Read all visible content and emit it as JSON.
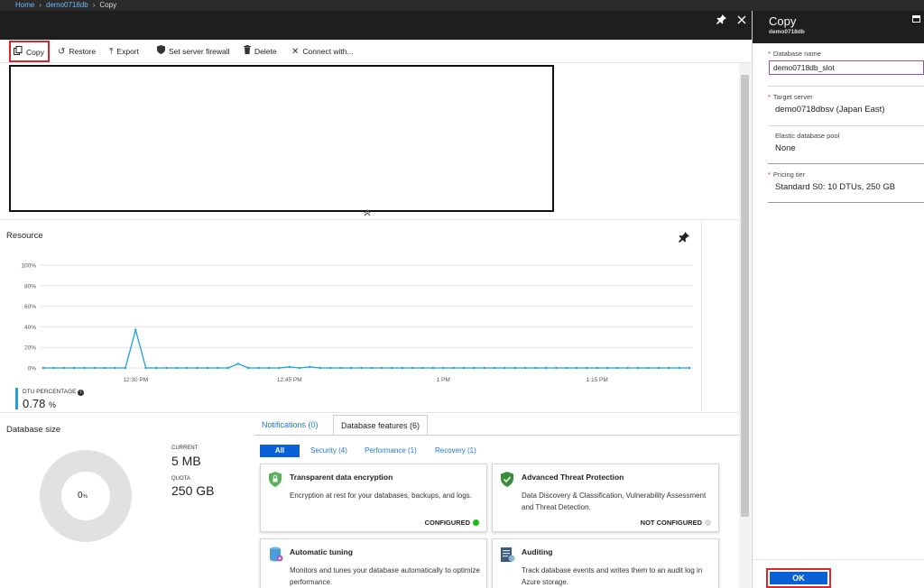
{
  "breadcrumb": {
    "home": "Home",
    "db": "demo0718db",
    "current": "Copy"
  },
  "toolbar": {
    "copy": "Copy",
    "restore": "Restore",
    "export": "Export",
    "firewall": "Set server firewall",
    "delete": "Delete",
    "connect": "Connect with..."
  },
  "resource": {
    "title": "Resource"
  },
  "chart_data": {
    "type": "line",
    "title": "",
    "y_ticks": [
      "100%",
      "80%",
      "60%",
      "40%",
      "20%",
      "0%"
    ],
    "ylim": [
      0,
      100
    ],
    "x_tick_labels": [
      "12:30 PM",
      "12:45 PM",
      "1 PM",
      "1:15 PM"
    ],
    "x_tick_positions": [
      9,
      24,
      39,
      54
    ],
    "series": [
      {
        "values": [
          0,
          0,
          0,
          0,
          0,
          0,
          0,
          0,
          0,
          37,
          0,
          0,
          0,
          0,
          0,
          0,
          0,
          0,
          0,
          4,
          0,
          0,
          0,
          0,
          1,
          0,
          1,
          0,
          0,
          0,
          0,
          0,
          0,
          0,
          0,
          0,
          0,
          0,
          0,
          0,
          0,
          0,
          0,
          0,
          0,
          0,
          0,
          0,
          0,
          0,
          0,
          0,
          0,
          0,
          0,
          0,
          0,
          0,
          0,
          0,
          0,
          0,
          0,
          0
        ],
        "color": "#1ba1e2"
      }
    ],
    "grid": true
  },
  "dtu": {
    "label": "DTU PERCENTAGE",
    "value": "0.78",
    "unit": "%"
  },
  "db_size": {
    "title": "Database size",
    "donut_value": "0",
    "donut_unit": "%",
    "current_label": "CURRENT",
    "current_value": "5 MB",
    "quota_label": "QUOTA",
    "quota_value": "250 GB"
  },
  "tabs": {
    "notifications": "Notifications (0)",
    "features": "Database features (6)"
  },
  "filters": {
    "all": "All",
    "security": "Security (4)",
    "performance": "Performance (1)",
    "recovery": "Recovery (1)"
  },
  "cards": {
    "tde": {
      "title": "Transparent data encryption",
      "desc": "Encryption at rest for your databases, backups, and logs.",
      "status": "CONFIGURED",
      "status_color": "#13c013"
    },
    "atp": {
      "title": "Advanced Threat Protection",
      "desc": "Data Discovery & Classification, Vulnerability Assessment and Threat Detection.",
      "status": "NOT CONFIGURED",
      "status_color": "#d9d9d9"
    },
    "tuning": {
      "title": "Automatic tuning",
      "desc": "Monitors and tunes your database automatically to optimize performance."
    },
    "auditing": {
      "title": "Auditing",
      "desc": "Track database events and writes them to an audit log in Azure storage."
    }
  },
  "copy_panel": {
    "title": "Copy",
    "subtitle": "demo0718db",
    "db_name_label": "Database name",
    "db_name_value": "demo0718db_slot",
    "target_label": "Target server",
    "target_value": "demo0718dbsv (Japan East)",
    "pool_label": "Elastic database pool",
    "pool_value": "None",
    "tier_label": "Pricing tier",
    "tier_value": "Standard S0: 10 DTUs, 250 GB",
    "ok": "OK"
  },
  "colors": {
    "accent": "#0a60d6",
    "highlight": "#d9262b",
    "series": "#1ba1e2"
  }
}
